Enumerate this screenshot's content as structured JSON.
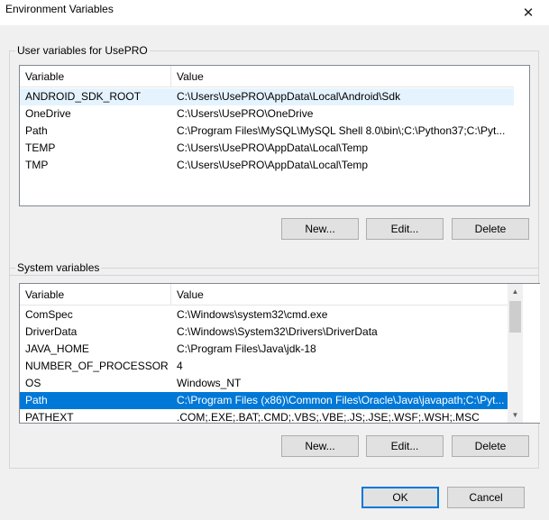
{
  "window": {
    "title": "Environment Variables",
    "close_glyph": "✕"
  },
  "user_vars": {
    "group_label": "User variables for UsePRO",
    "col_variable": "Variable",
    "col_value": "Value",
    "rows": [
      {
        "name": "ANDROID_SDK_ROOT",
        "value": "C:\\Users\\UsePRO\\AppData\\Local\\Android\\Sdk"
      },
      {
        "name": "OneDrive",
        "value": "C:\\Users\\UsePRO\\OneDrive"
      },
      {
        "name": "Path",
        "value": "C:\\Program Files\\MySQL\\MySQL Shell 8.0\\bin\\;C:\\Python37;C:\\Pyt..."
      },
      {
        "name": "TEMP",
        "value": "C:\\Users\\UsePRO\\AppData\\Local\\Temp"
      },
      {
        "name": "TMP",
        "value": "C:\\Users\\UsePRO\\AppData\\Local\\Temp"
      }
    ],
    "new_label": "New...",
    "edit_label": "Edit...",
    "delete_label": "Delete"
  },
  "system_vars": {
    "group_label": "System variables",
    "col_variable": "Variable",
    "col_value": "Value",
    "rows": [
      {
        "name": "ComSpec",
        "value": "C:\\Windows\\system32\\cmd.exe"
      },
      {
        "name": "DriverData",
        "value": "C:\\Windows\\System32\\Drivers\\DriverData"
      },
      {
        "name": "JAVA_HOME",
        "value": "C:\\Program Files\\Java\\jdk-18"
      },
      {
        "name": "NUMBER_OF_PROCESSORS",
        "value": "4"
      },
      {
        "name": "OS",
        "value": "Windows_NT"
      },
      {
        "name": "Path",
        "value": "C:\\Program Files (x86)\\Common Files\\Oracle\\Java\\javapath;C:\\Pyt..."
      },
      {
        "name": "PATHEXT",
        "value": ".COM;.EXE;.BAT;.CMD;.VBS;.VBE;.JS;.JSE;.WSF;.WSH;.MSC"
      }
    ],
    "selected_index": 5,
    "new_label": "New...",
    "edit_label": "Edit...",
    "delete_label": "Delete",
    "scroll_up_glyph": "▲",
    "scroll_down_glyph": "▼"
  },
  "footer": {
    "ok_label": "OK",
    "cancel_label": "Cancel"
  },
  "colors": {
    "selection": "#0078d7",
    "hover": "#e5f3ff",
    "dialog_bg": "#f0f0f0"
  }
}
